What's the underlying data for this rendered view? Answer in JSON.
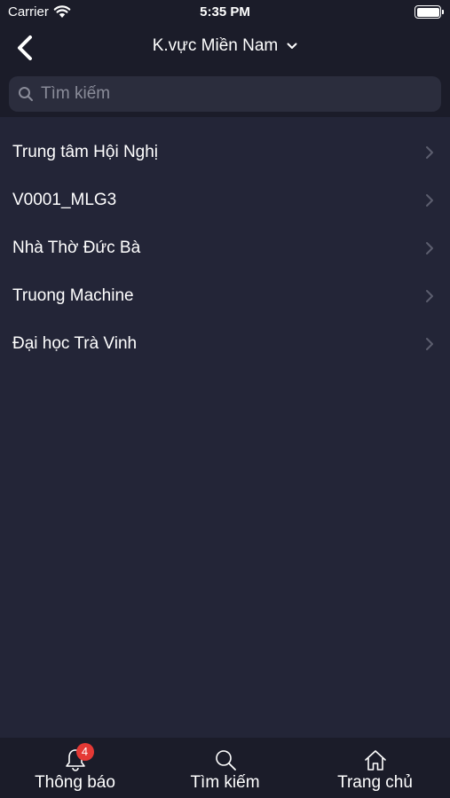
{
  "status_bar": {
    "carrier": "Carrier",
    "time": "5:35 PM",
    "wifi_icon": "wifi-icon",
    "battery_icon": "battery-icon"
  },
  "nav": {
    "back_icon": "chevron-left-icon",
    "title": "K.vực Miền Nam",
    "dropdown_icon": "chevron-down-icon"
  },
  "search": {
    "placeholder": "Tìm kiếm",
    "value": "",
    "icon": "search-icon"
  },
  "list": {
    "items": [
      {
        "label": "Trung tâm Hội Nghị"
      },
      {
        "label": "V0001_MLG3"
      },
      {
        "label": "Nhà Thờ Đức Bà"
      },
      {
        "label": "Truong Machine"
      },
      {
        "label": "Đại học Trà Vinh"
      }
    ],
    "item_icon": "chevron-right-icon"
  },
  "tab_bar": {
    "tabs": [
      {
        "label": "Thông báo",
        "icon": "bell-icon",
        "badge": "4"
      },
      {
        "label": "Tìm kiếm",
        "icon": "search-icon"
      },
      {
        "label": "Trang chủ",
        "icon": "home-icon"
      }
    ]
  },
  "colors": {
    "background": "#232537",
    "bar_background": "#1b1c29",
    "search_field": "#2b2d3d",
    "badge": "#e53935",
    "chevron": "#5c5e6e"
  }
}
